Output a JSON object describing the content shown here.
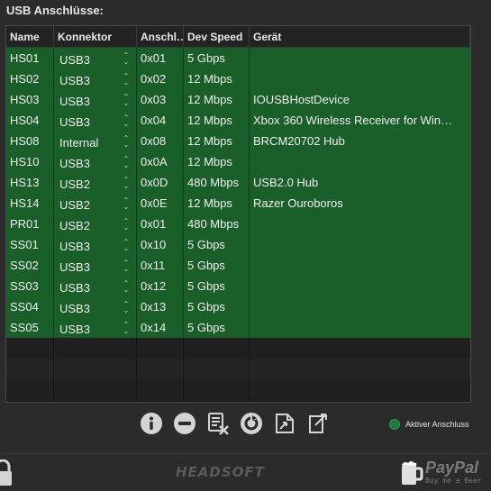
{
  "section": {
    "title": "USB Anschlüsse:"
  },
  "columns": [
    "Name",
    "Konnektor",
    "Anschl…",
    "Dev Speed",
    "Gerät"
  ],
  "ports": [
    {
      "name": "HS01",
      "connector": "USB3",
      "address": "0x01",
      "speed": "5 Gbps",
      "device": ""
    },
    {
      "name": "HS02",
      "connector": "USB3",
      "address": "0x02",
      "speed": "12 Mbps",
      "device": ""
    },
    {
      "name": "HS03",
      "connector": "USB3",
      "address": "0x03",
      "speed": "12 Mbps",
      "device": "IOUSBHostDevice"
    },
    {
      "name": "HS04",
      "connector": "USB3",
      "address": "0x04",
      "speed": "12 Mbps",
      "device": "Xbox 360 Wireless Receiver for Win…"
    },
    {
      "name": "HS08",
      "connector": "Internal",
      "address": "0x08",
      "speed": "12 Mbps",
      "device": "BRCM20702 Hub"
    },
    {
      "name": "HS10",
      "connector": "USB3",
      "address": "0x0A",
      "speed": "12 Mbps",
      "device": ""
    },
    {
      "name": "HS13",
      "connector": "USB2",
      "address": "0x0D",
      "speed": "480 Mbps",
      "device": "USB2.0 Hub"
    },
    {
      "name": "HS14",
      "connector": "USB2",
      "address": "0x0E",
      "speed": "12 Mbps",
      "device": "Razer Ouroboros"
    },
    {
      "name": "PR01",
      "connector": "USB2",
      "address": "0x01",
      "speed": "480 Mbps",
      "device": ""
    },
    {
      "name": "SS01",
      "connector": "USB3",
      "address": "0x10",
      "speed": "5 Gbps",
      "device": ""
    },
    {
      "name": "SS02",
      "connector": "USB3",
      "address": "0x11",
      "speed": "5 Gbps",
      "device": ""
    },
    {
      "name": "SS03",
      "connector": "USB3",
      "address": "0x12",
      "speed": "5 Gbps",
      "device": ""
    },
    {
      "name": "SS04",
      "connector": "USB3",
      "address": "0x13",
      "speed": "5 Gbps",
      "device": ""
    },
    {
      "name": "SS05",
      "connector": "USB3",
      "address": "0x14",
      "speed": "5 Gbps",
      "device": ""
    }
  ],
  "empty_rows": 3,
  "toolbar": {
    "buttons": [
      {
        "icon": "info-icon"
      },
      {
        "icon": "remove-icon"
      },
      {
        "icon": "clear-list-icon"
      },
      {
        "icon": "refresh-icon"
      },
      {
        "icon": "import-icon"
      },
      {
        "icon": "export-icon"
      }
    ]
  },
  "legend": {
    "label": "Aktiver Anschluss",
    "color": "#1f7a3a"
  },
  "footer": {
    "brand": "HEADSOFT",
    "donate_logo": "PayPal",
    "donate_sub": "Buy me a Beer"
  },
  "colors": {
    "active_row": "#1a5e2a",
    "background": "#2b2b2b"
  }
}
